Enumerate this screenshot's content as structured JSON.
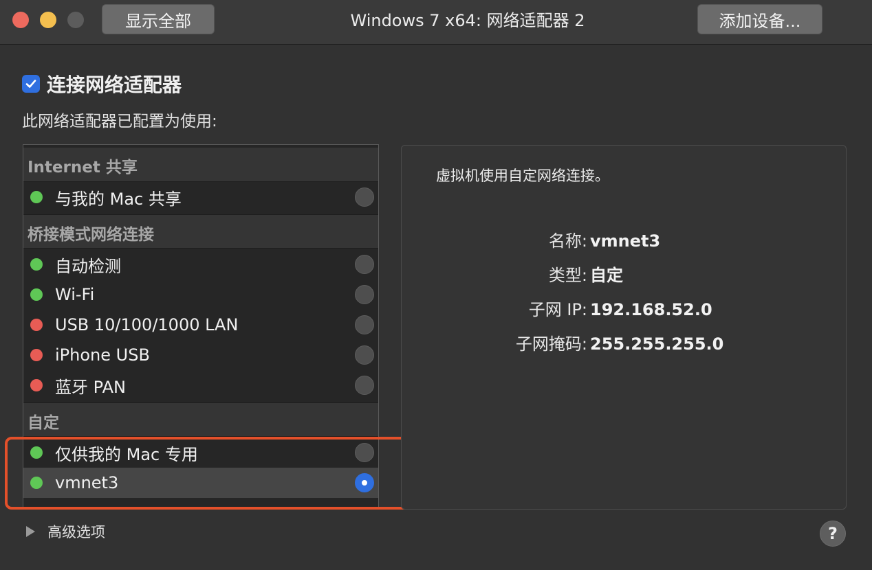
{
  "window": {
    "title": "Windows 7 x64: 网络适配器 2",
    "show_all_label": "显示全部",
    "add_device_label": "添加设备..."
  },
  "connect": {
    "label": "连接网络适配器",
    "checked": true
  },
  "description": "此网络适配器已配置为使用:",
  "groups": [
    {
      "header": "Internet 共享",
      "items": [
        {
          "label": "与我的 Mac 共享",
          "status": "green",
          "selected": false
        }
      ]
    },
    {
      "header": "桥接模式网络连接",
      "items": [
        {
          "label": "自动检测",
          "status": "green",
          "selected": false
        },
        {
          "label": "Wi-Fi",
          "status": "green",
          "selected": false
        },
        {
          "label": "USB 10/100/1000 LAN",
          "status": "red",
          "selected": false
        },
        {
          "label": "iPhone USB",
          "status": "red",
          "selected": false
        },
        {
          "label": "蓝牙 PAN",
          "status": "red",
          "selected": false
        }
      ]
    },
    {
      "header": "自定",
      "items": [
        {
          "label": "仅供我的 Mac 专用",
          "status": "green",
          "selected": false
        },
        {
          "label": "vmnet3",
          "status": "green",
          "selected": true
        }
      ]
    }
  ],
  "detail": {
    "description": "虚拟机使用自定网络连接。",
    "fields": [
      {
        "key": "名称:",
        "value": "vmnet3"
      },
      {
        "key": "类型:",
        "value": "自定"
      },
      {
        "key": "子网 IP:",
        "value": "192.168.52.0"
      },
      {
        "key": "子网掩码:",
        "value": "255.255.255.0"
      }
    ]
  },
  "advanced_label": "高级选项",
  "help_label": "?",
  "colors": {
    "status_green": "#5fc756",
    "status_red": "#e85c55",
    "accent_blue": "#2f6fe0",
    "highlight_orange": "#e4502a"
  }
}
